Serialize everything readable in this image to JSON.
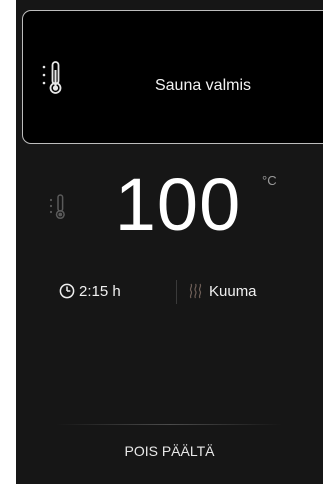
{
  "status_card": {
    "icon": "thermometer-icon",
    "label": "Sauna valmis"
  },
  "temperature": {
    "icon": "thermometer-icon",
    "value": "100",
    "unit": "°C"
  },
  "info": {
    "time_icon": "clock-icon",
    "time": "2:15 h",
    "mode_icon": "heat-waves-icon",
    "mode": "Kuuma"
  },
  "controls": {
    "off_label": "POIS PÄÄLTÄ"
  },
  "colors": {
    "background": "#161616",
    "card_background": "#000000",
    "card_border": "#bdbdbd",
    "text": "#ffffff",
    "muted": "#9a9a9a",
    "heat_icon": "#6e5f58"
  }
}
